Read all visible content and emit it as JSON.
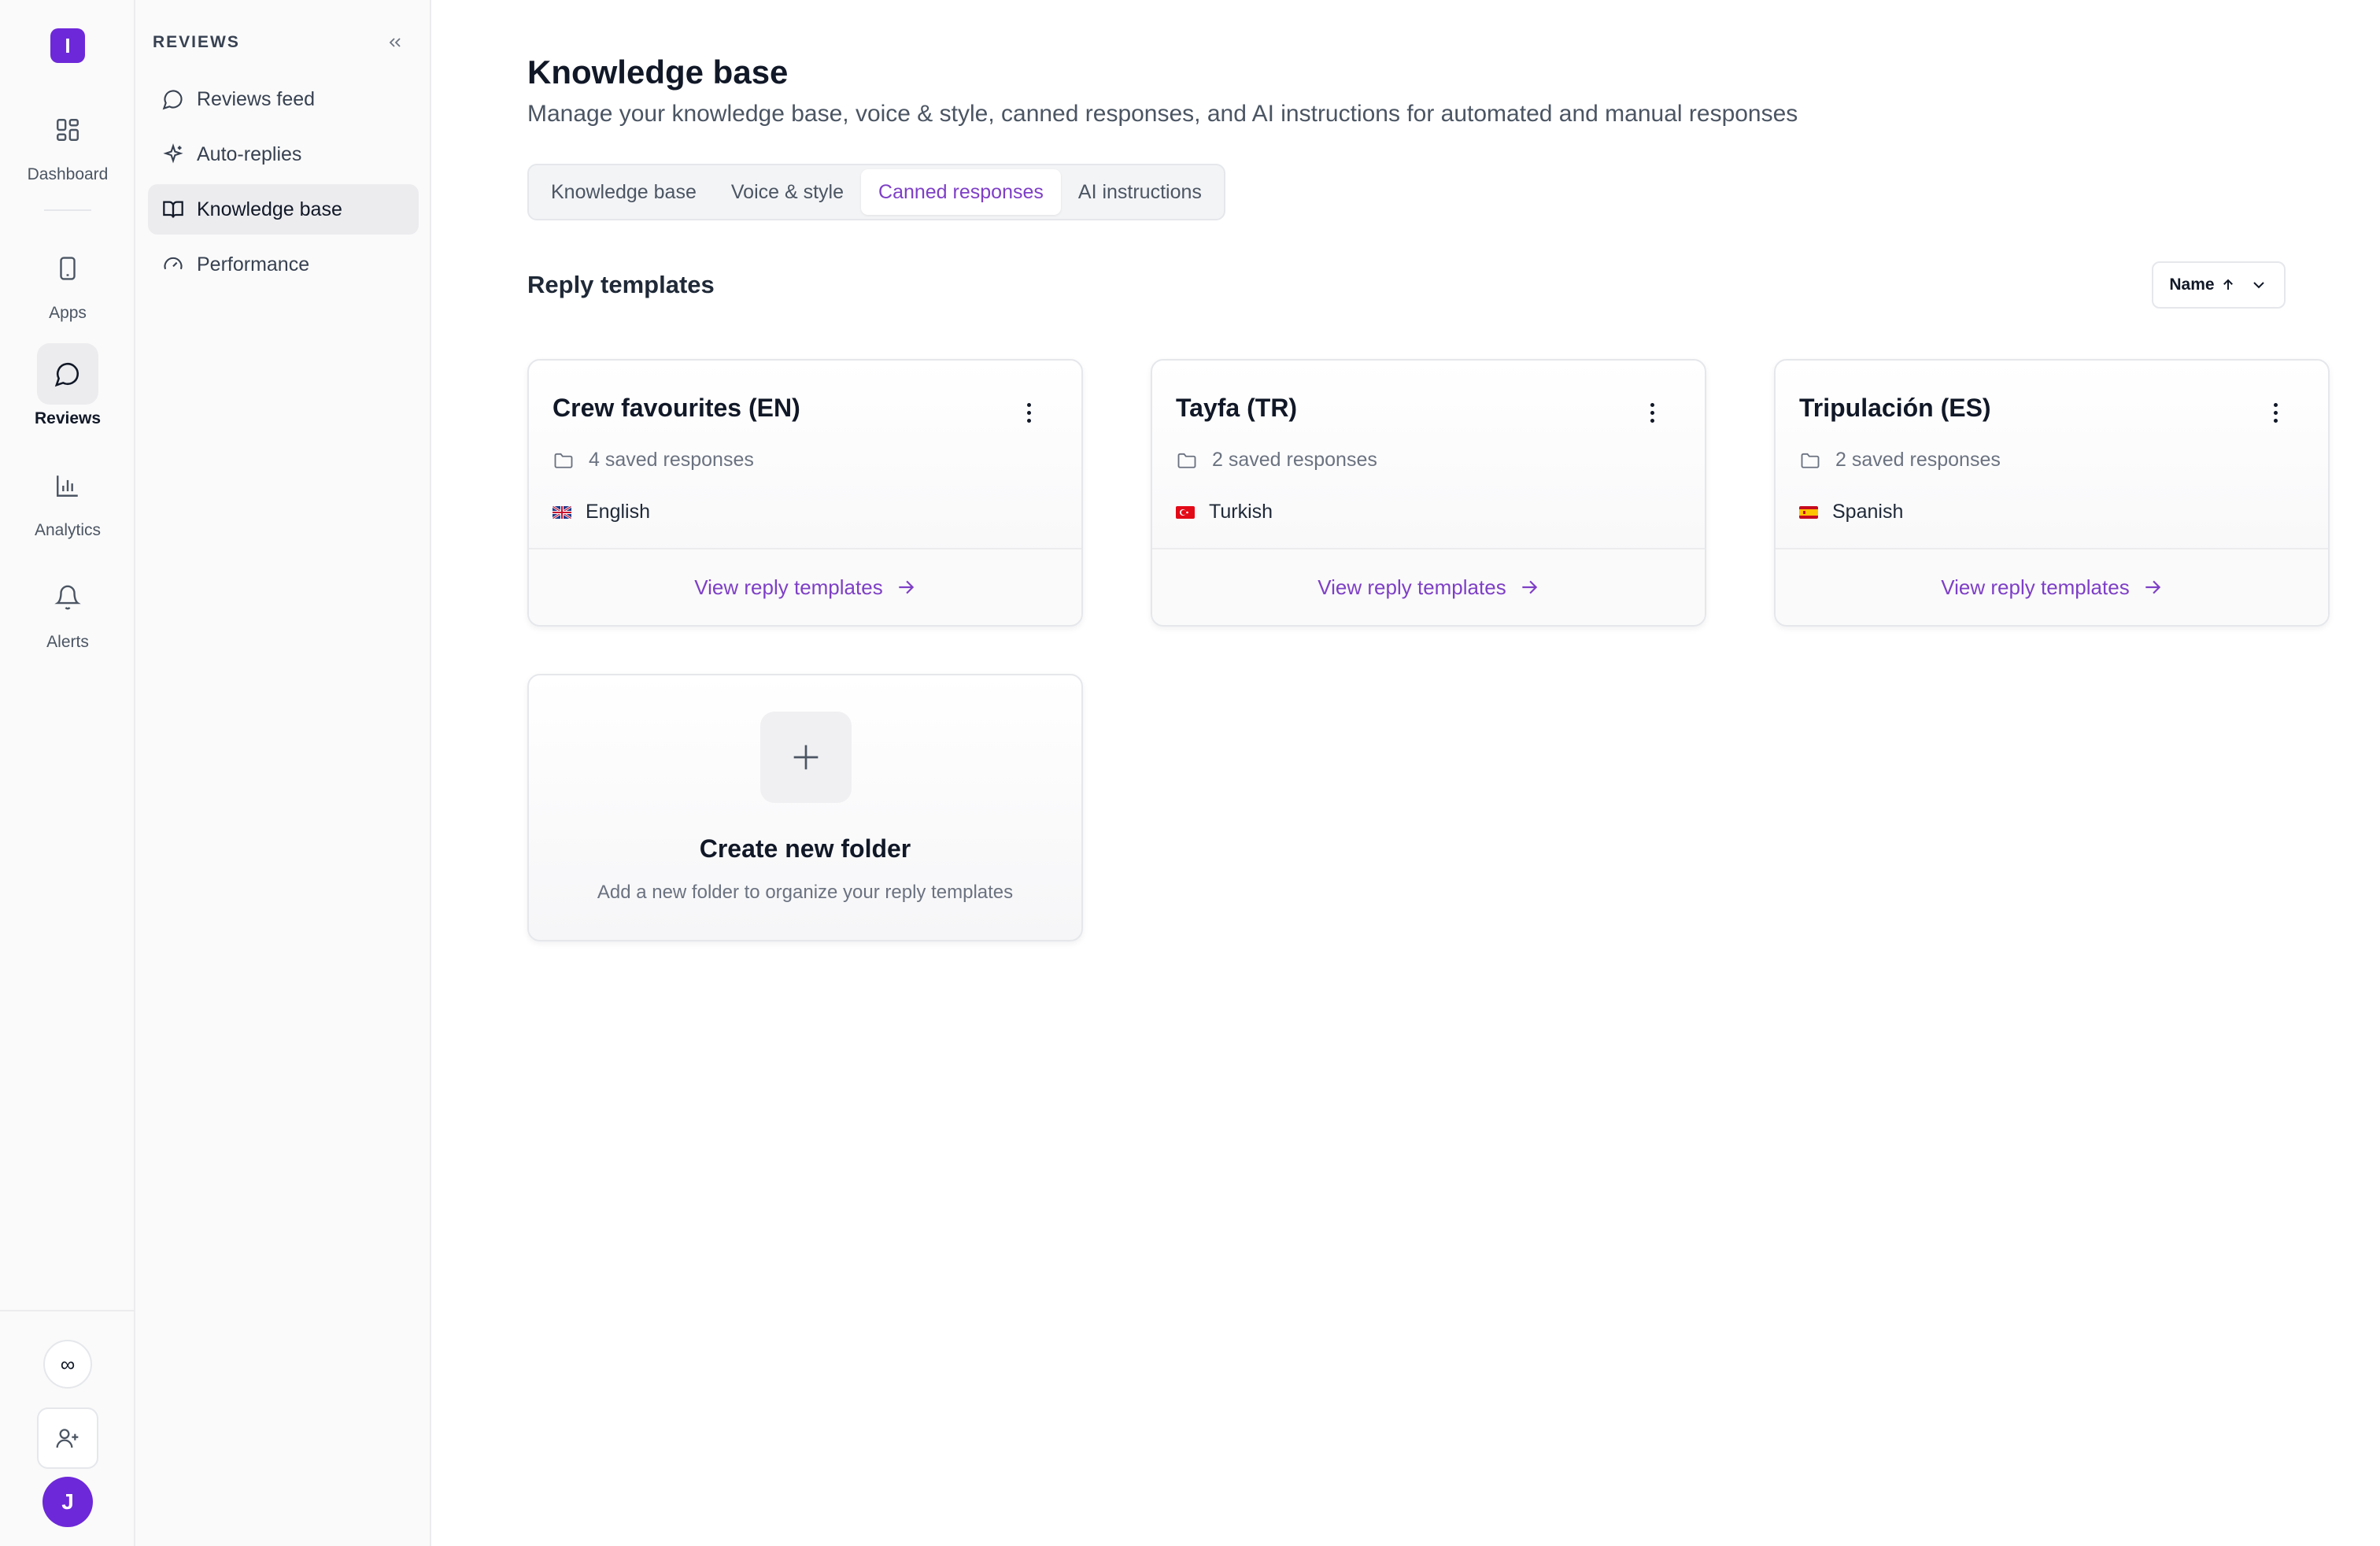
{
  "rail": {
    "logo_letter": "I",
    "items": [
      {
        "label": "Dashboard",
        "icon": "dashboard-icon"
      },
      {
        "label": "Apps",
        "icon": "phone-icon"
      },
      {
        "label": "Reviews",
        "icon": "chat-bubble-icon",
        "active": true
      },
      {
        "label": "Analytics",
        "icon": "bar-chart-icon"
      },
      {
        "label": "Alerts",
        "icon": "bell-icon"
      }
    ],
    "infinity_symbol": "∞",
    "avatar_initial": "J"
  },
  "sidebar": {
    "title": "REVIEWS",
    "items": [
      {
        "label": "Reviews feed",
        "icon": "chat-bubble-icon"
      },
      {
        "label": "Auto-replies",
        "icon": "sparkle-icon"
      },
      {
        "label": "Knowledge base",
        "icon": "book-icon",
        "active": true
      },
      {
        "label": "Performance",
        "icon": "gauge-icon"
      }
    ]
  },
  "main": {
    "title": "Knowledge base",
    "subtitle": "Manage your knowledge base, voice & style, canned responses, and AI instructions for automated and manual responses",
    "tabs": [
      {
        "label": "Knowledge base"
      },
      {
        "label": "Voice & style"
      },
      {
        "label": "Canned responses",
        "active": true
      },
      {
        "label": "AI instructions"
      }
    ],
    "section_title": "Reply templates",
    "sort_label": "Name"
  },
  "folders": [
    {
      "title": "Crew favourites (EN)",
      "count": "4 saved responses",
      "language": "English",
      "flag": "uk-flag-icon",
      "link": "View reply templates"
    },
    {
      "title": "Tayfa (TR)",
      "count": "2 saved responses",
      "language": "Turkish",
      "flag": "turkey-flag-icon",
      "link": "View reply templates"
    },
    {
      "title": "Tripulación (ES)",
      "count": "2 saved responses",
      "language": "Spanish",
      "flag": "spain-flag-icon",
      "link": "View reply templates"
    }
  ],
  "create_folder": {
    "title": "Create new folder",
    "subtitle": "Add a new folder to organize your reply templates"
  },
  "colors": {
    "accent": "#7e3fc6",
    "brand": "#6d28d9"
  }
}
